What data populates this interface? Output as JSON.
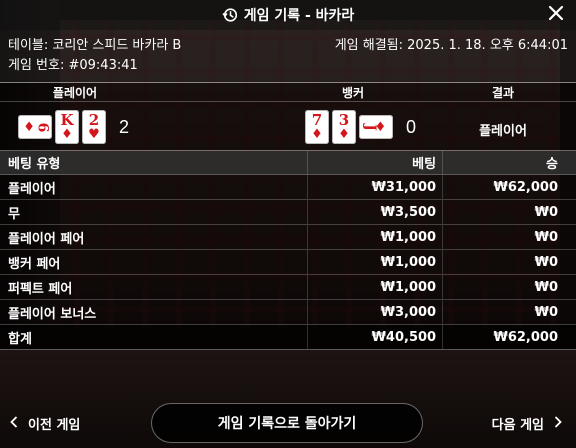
{
  "header": {
    "title": "게임 기록 - 바카라"
  },
  "info": {
    "table_label": "테이블: 코리안 스피드 바카라 B",
    "settled_label": "게임 해결됨: 2025. 1. 18. 오후 6:44:01",
    "game_number_label": "게임 번호: #09:43:41"
  },
  "results": {
    "player_header": "플레이어",
    "banker_header": "뱅커",
    "result_header": "결과",
    "player_cards": [
      {
        "rank": "6",
        "suit": "♦",
        "orientation": "sideways"
      },
      {
        "rank": "K",
        "suit": "♦",
        "orientation": "upright"
      },
      {
        "rank": "2",
        "suit": "♥",
        "orientation": "upright"
      }
    ],
    "player_score": "2",
    "banker_cards": [
      {
        "rank": "7",
        "suit": "♦",
        "orientation": "upright"
      },
      {
        "rank": "3",
        "suit": "♦",
        "orientation": "upright"
      },
      {
        "rank": "J",
        "suit": "♦",
        "orientation": "sideways"
      }
    ],
    "banker_score": "0",
    "result_text": "플레이어",
    "card_color": "#d3161b"
  },
  "bets": {
    "headers": {
      "type": "베팅 유형",
      "bet": "베팅",
      "win": "승"
    },
    "rows": [
      {
        "type": "플레이어",
        "bet": "₩31,000",
        "win": "₩62,000"
      },
      {
        "type": "무",
        "bet": "₩3,500",
        "win": "₩0"
      },
      {
        "type": "플레이어 페어",
        "bet": "₩1,000",
        "win": "₩0"
      },
      {
        "type": "뱅커 페어",
        "bet": "₩1,000",
        "win": "₩0"
      },
      {
        "type": "퍼펙트 페어",
        "bet": "₩1,000",
        "win": "₩0"
      },
      {
        "type": "플레이어 보너스",
        "bet": "₩3,000",
        "win": "₩0"
      }
    ],
    "total": {
      "type": "합계",
      "bet": "₩40,500",
      "win": "₩62,000"
    }
  },
  "footer": {
    "prev_label": "이전 게임",
    "back_label": "게임 기록으로 돌아가기",
    "next_label": "다음 게임"
  },
  "icons": {
    "history": "history-icon",
    "close": "close-icon",
    "prev": "chevron-left-icon",
    "next": "chevron-right-icon"
  }
}
